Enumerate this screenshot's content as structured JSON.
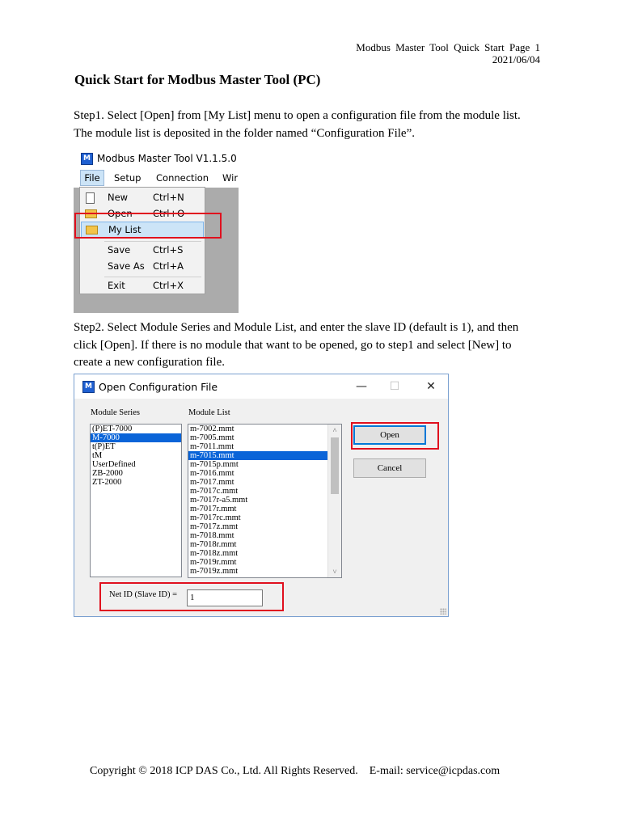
{
  "header": {
    "line1": "Modbus  Master  Tool  Quick  Start  Page  1",
    "date": "2021/06/04"
  },
  "title": "Quick Start for Modbus Master Tool (PC)",
  "step1": {
    "line1": "Step1. Select [Open] from [My List] menu to open a configuration file from the module list.",
    "line2": "The module list is deposited in the folder named “Configuration File”."
  },
  "shot1": {
    "app_icon": "M",
    "window_title": "Modbus Master Tool V1.1.5.0  2",
    "menu": [
      "File",
      "Setup",
      "Connection",
      "Wir"
    ],
    "items": [
      {
        "label": "New",
        "shortcut": "Ctrl+N",
        "icon": "new-document-icon"
      },
      {
        "label": "Open",
        "shortcut": "Ctrl+O",
        "icon": "folder-open-icon"
      },
      {
        "label": "My List",
        "shortcut": "",
        "icon": "folder-open-icon"
      },
      {
        "label": "Save",
        "shortcut": "Ctrl+S",
        "icon": ""
      },
      {
        "label": "Save As",
        "shortcut": "Ctrl+A",
        "icon": ""
      },
      {
        "label": "Exit",
        "shortcut": "Ctrl+X",
        "icon": ""
      }
    ]
  },
  "step2": {
    "line1": "Step2. Select Module Series and Module List, and enter the slave ID (default is 1), and then",
    "line2": "click [Open]. If there is no module that want to be opened, go to step1 and select [New] to",
    "line3": "create a new configuration file."
  },
  "shot2": {
    "app_icon": "M",
    "window_title": "Open Configuration File",
    "window_buttons": {
      "minimize": "—",
      "maximize": "☐",
      "close": "✕"
    },
    "module_series_label": "Module Series",
    "module_list_label": "Module List",
    "series": [
      "(P)ET-7000",
      "M-7000",
      "t(P)ET",
      "tM",
      "UserDefined",
      "ZB-2000",
      "ZT-2000"
    ],
    "series_selected": "M-7000",
    "modules": [
      "m-7002.mmt",
      "m-7005.mmt",
      "m-7011.mmt",
      "m-7015.mmt",
      "m-7015p.mmt",
      "m-7016.mmt",
      "m-7017.mmt",
      "m-7017c.mmt",
      "m-7017r-a5.mmt",
      "m-7017r.mmt",
      "m-7017rc.mmt",
      "m-7017z.mmt",
      "m-7018.mmt",
      "m-7018r.mmt",
      "m-7018z.mmt",
      "m-7019r.mmt",
      "m-7019z.mmt"
    ],
    "module_selected": "m-7015.mmt",
    "open_label": "Open",
    "cancel_label": "Cancel",
    "net_id_label": "Net ID (Slave ID) =",
    "net_id_value": "1",
    "scroll_up": "˄",
    "scroll_down": "˅"
  },
  "footer": "Copyright © 2018 ICP DAS Co., Ltd. All Rights Reserved.    E-mail: service@icpdas.com",
  "colors": {
    "highlight_box": "#e0101e",
    "selection": "#0a64d8",
    "menu_hover": "#cce4f7"
  }
}
